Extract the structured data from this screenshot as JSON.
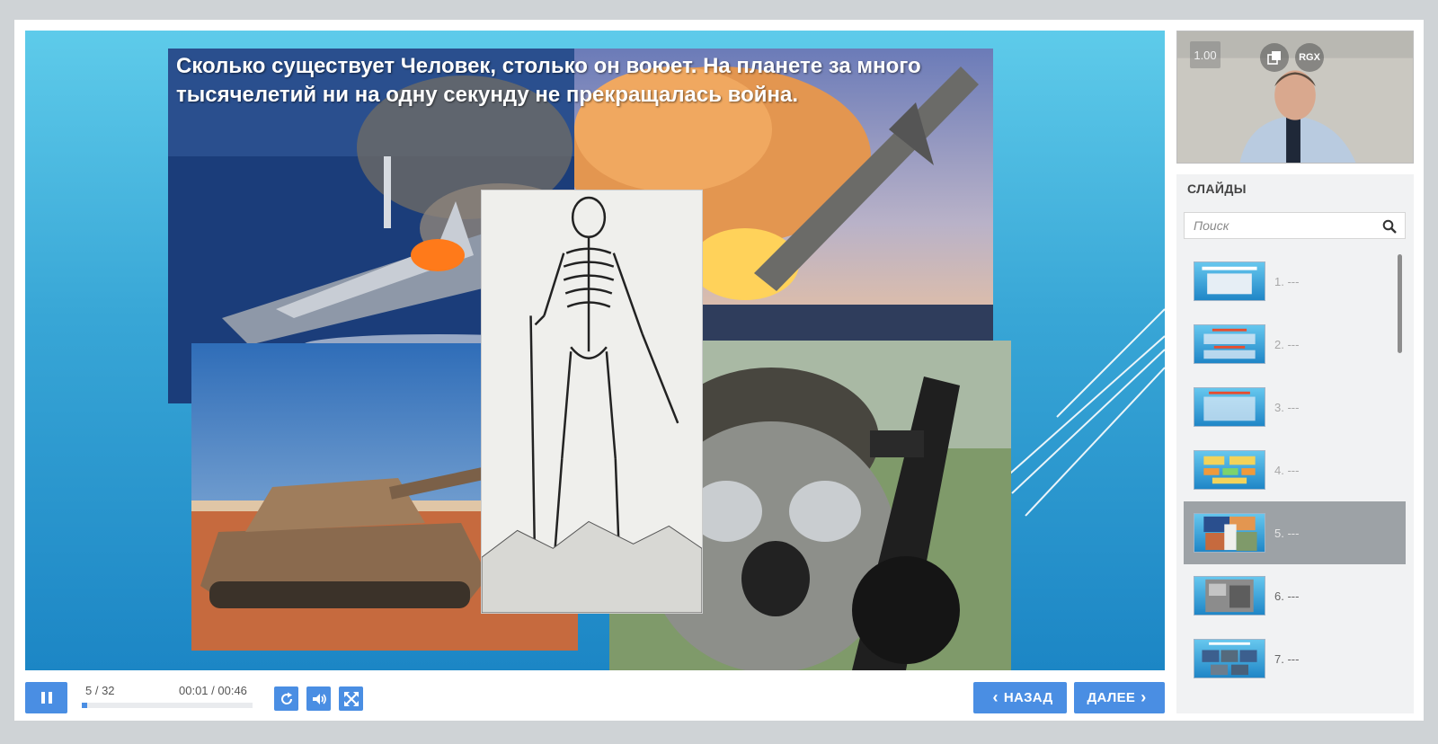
{
  "slide": {
    "caption": "Сколько существует Человек, столько он воюет. На планете за много тысячелетий ни на одну секунду не прекращалась война."
  },
  "player": {
    "counter": "5 / 32",
    "time": "00:01 / 00:46",
    "progress": 0.03,
    "back_label": "НАЗАД",
    "next_label": "ДАЛЕЕ"
  },
  "video": {
    "speed": "1.00",
    "badge": "RGX"
  },
  "panel": {
    "title": "СЛАЙДЫ",
    "search_placeholder": "Поиск",
    "slides": [
      {
        "label": "1. ---"
      },
      {
        "label": "2. ---"
      },
      {
        "label": "3. ---"
      },
      {
        "label": "4. ---"
      },
      {
        "label": "5. ---",
        "active": true
      },
      {
        "label": "6. ---"
      },
      {
        "label": "7. ---"
      }
    ]
  },
  "colors": {
    "accent": "#4a8ee3",
    "active_item": "#9da2a6"
  }
}
